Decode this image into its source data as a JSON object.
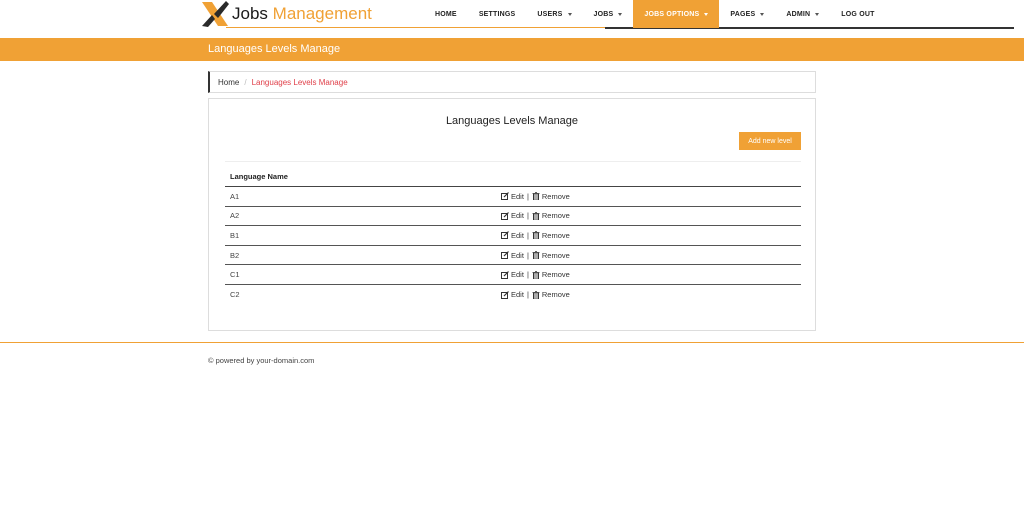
{
  "brand": {
    "name_part1": "Jobs",
    "name_part2": "Management",
    "accent": "#f0a135"
  },
  "nav": {
    "items": [
      {
        "label": "HOME",
        "dropdown": false,
        "active": false
      },
      {
        "label": "SETTINGS",
        "dropdown": false,
        "active": false
      },
      {
        "label": "USERS",
        "dropdown": true,
        "active": false
      },
      {
        "label": "JOBS",
        "dropdown": true,
        "active": false
      },
      {
        "label": "JOBS OPTIONS",
        "dropdown": true,
        "active": true
      },
      {
        "label": "PAGES",
        "dropdown": true,
        "active": false
      },
      {
        "label": "ADMIN",
        "dropdown": true,
        "active": false
      },
      {
        "label": "LOG OUT",
        "dropdown": false,
        "active": false
      }
    ]
  },
  "band": {
    "title": "Languages Levels Manage"
  },
  "breadcrumb": {
    "home": "Home",
    "separator": "/",
    "current": "Languages Levels Manage"
  },
  "panel": {
    "title": "Languages Levels Manage",
    "add_button": "Add new level",
    "table": {
      "header": "Language Name",
      "edit_label": "Edit",
      "action_separator": "|",
      "remove_label": "Remove",
      "rows": [
        "A1",
        "A2",
        "B1",
        "B2",
        "C1",
        "C2"
      ]
    }
  },
  "footer": {
    "text": "© powered by your-domain.com"
  },
  "icons": {
    "edit": "edit-icon",
    "remove": "trash-icon",
    "caret": "caret-down-icon"
  }
}
